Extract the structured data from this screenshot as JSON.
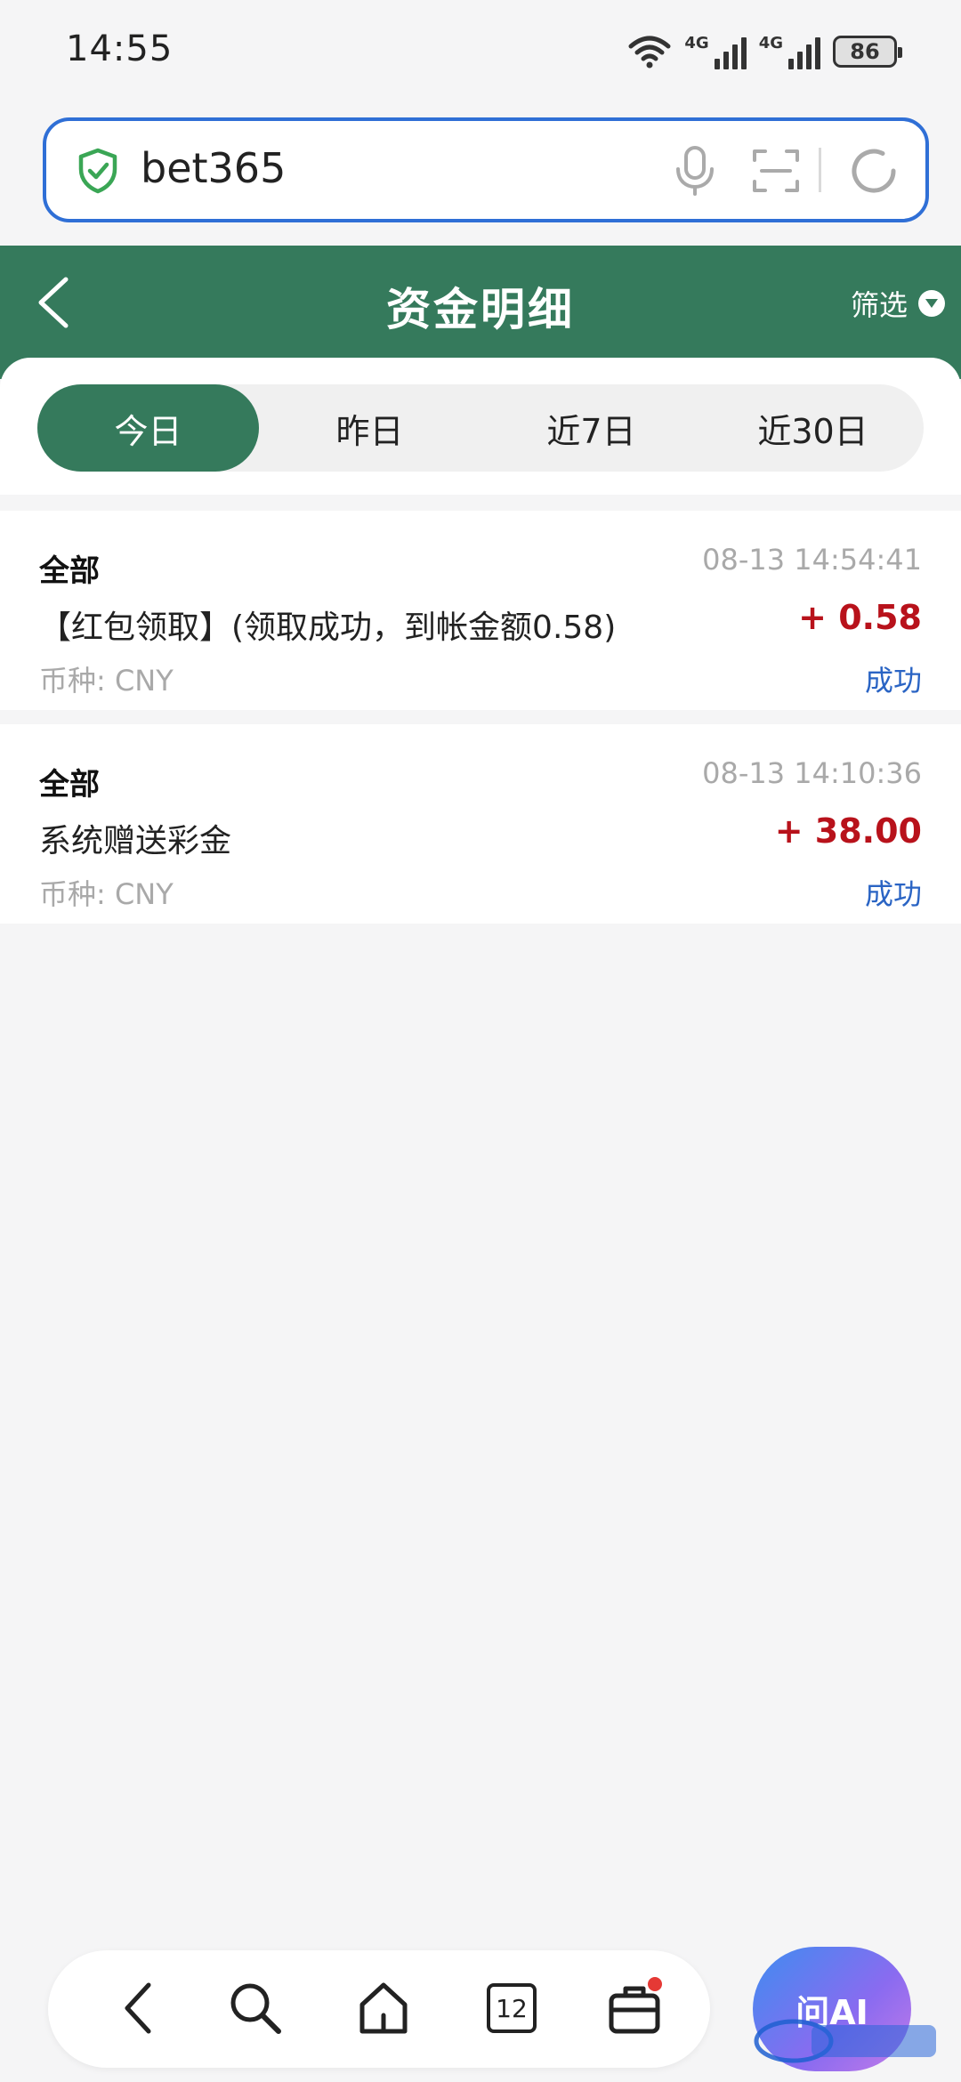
{
  "status_bar": {
    "time": "14:55",
    "network_1": "4G",
    "network_2": "4G",
    "battery": "86"
  },
  "address_bar": {
    "url": "bet365",
    "icons": [
      "shield-check-icon",
      "mic-icon",
      "scan-icon",
      "reload-icon"
    ]
  },
  "header": {
    "title": "资金明细",
    "filter_label": "筛选"
  },
  "tabs": [
    {
      "label": "今日",
      "active": true
    },
    {
      "label": "昨日",
      "active": false
    },
    {
      "label": "近7日",
      "active": false
    },
    {
      "label": "近30日",
      "active": false
    }
  ],
  "records": [
    {
      "category": "全部",
      "time": "08-13 14:54:41",
      "description": "【红包领取】(领取成功，到帐金额0.58)",
      "amount": "+ 0.58",
      "currency": "币种: CNY",
      "status": "成功"
    },
    {
      "category": "全部",
      "time": "08-13 14:10:36",
      "description": "系统赠送彩金",
      "amount": "+ 38.00",
      "currency": "币种: CNY",
      "status": "成功"
    }
  ],
  "bottom_nav": {
    "tab_count": "12",
    "ai_label": "问AI",
    "icons": [
      "back-icon",
      "search-icon",
      "home-icon",
      "tabs-icon",
      "toolbox-icon"
    ]
  },
  "colors": {
    "primary_green": "#357a5c",
    "amount_red": "#b8121b",
    "status_blue": "#2a64c4",
    "url_border_blue": "#2f6fd6"
  }
}
